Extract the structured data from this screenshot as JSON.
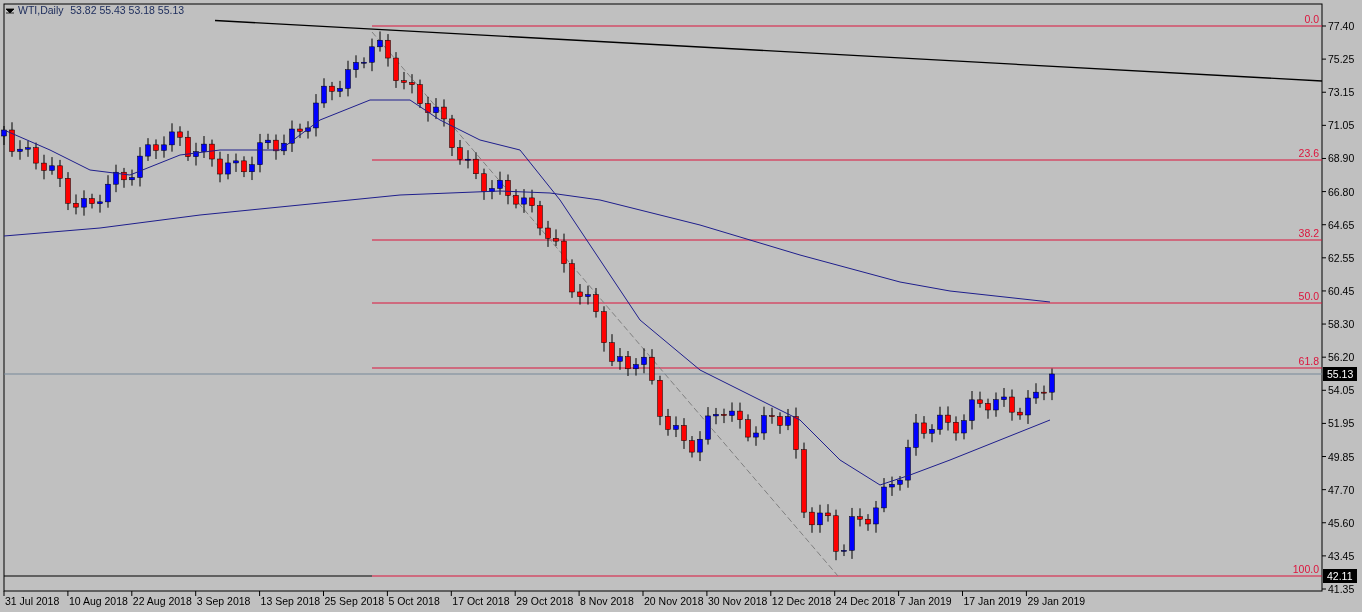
{
  "header": {
    "symbol": "WTI,Daily",
    "ohlc": "53.82 55.43 53.18 55.13"
  },
  "price_axis": {
    "ticks": [
      "77.40",
      "75.25",
      "73.15",
      "71.05",
      "68.90",
      "66.80",
      "64.65",
      "62.55",
      "60.45",
      "58.30",
      "56.20",
      "54.05",
      "51.95",
      "49.85",
      "47.70",
      "45.60",
      "43.45",
      "41.35"
    ]
  },
  "time_axis": {
    "labels": [
      "31 Jul 2018",
      "10 Aug 2018",
      "22 Aug 2018",
      "3 Sep 2018",
      "13 Sep 2018",
      "25 Sep 2018",
      "5 Oct 2018",
      "17 Oct 2018",
      "29 Oct 2018",
      "8 Nov 2018",
      "20 Nov 2018",
      "30 Nov 2018",
      "12 Dec 2018",
      "24 Dec 2018",
      "7 Jan 2019",
      "17 Jan 2019",
      "29 Jan 2019"
    ]
  },
  "fibonacci": {
    "levels": [
      "0.0",
      "23.6",
      "38.2",
      "50.0",
      "61.8",
      "100.0"
    ]
  },
  "price_tags": [
    "55.13",
    "42.11"
  ]
}
